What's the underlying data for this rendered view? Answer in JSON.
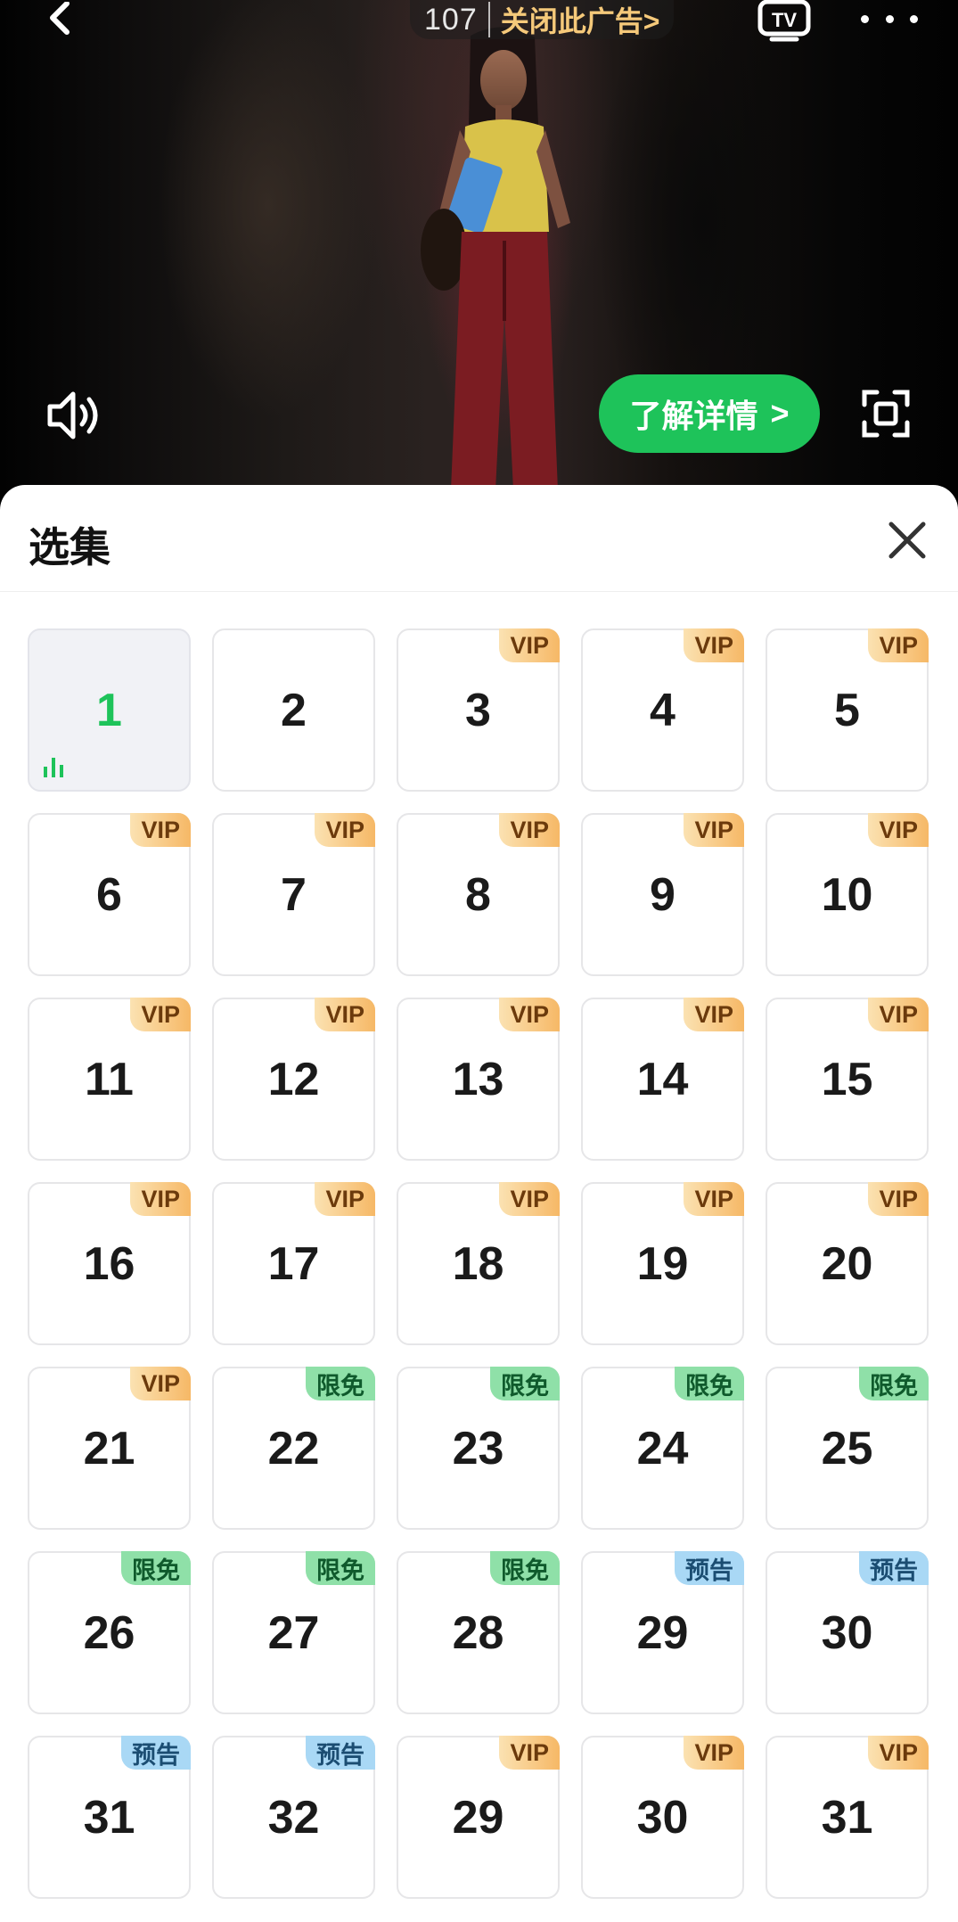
{
  "player": {
    "ad_countdown": "107",
    "close_ad_label": "关闭此广告>",
    "details_label": "了解详情",
    "details_chevron": ">",
    "icons": [
      "back-icon",
      "tv-cast-icon",
      "more-icon",
      "volume-icon",
      "fullscreen-icon"
    ]
  },
  "sheet": {
    "title": "选集",
    "close_icon": "close-icon"
  },
  "colors": {
    "accent_green": "#1ec35a",
    "vip_gold": "#f6b866",
    "free_green": "#8fe0a8",
    "preview_blue": "#a9d8f5"
  },
  "episodes": [
    {
      "num": "1",
      "badge": "",
      "type": "",
      "current": true
    },
    {
      "num": "2",
      "badge": "",
      "type": ""
    },
    {
      "num": "3",
      "badge": "VIP",
      "type": "vip"
    },
    {
      "num": "4",
      "badge": "VIP",
      "type": "vip"
    },
    {
      "num": "5",
      "badge": "VIP",
      "type": "vip"
    },
    {
      "num": "6",
      "badge": "VIP",
      "type": "vip"
    },
    {
      "num": "7",
      "badge": "VIP",
      "type": "vip"
    },
    {
      "num": "8",
      "badge": "VIP",
      "type": "vip"
    },
    {
      "num": "9",
      "badge": "VIP",
      "type": "vip"
    },
    {
      "num": "10",
      "badge": "VIP",
      "type": "vip"
    },
    {
      "num": "11",
      "badge": "VIP",
      "type": "vip"
    },
    {
      "num": "12",
      "badge": "VIP",
      "type": "vip"
    },
    {
      "num": "13",
      "badge": "VIP",
      "type": "vip"
    },
    {
      "num": "14",
      "badge": "VIP",
      "type": "vip"
    },
    {
      "num": "15",
      "badge": "VIP",
      "type": "vip"
    },
    {
      "num": "16",
      "badge": "VIP",
      "type": "vip"
    },
    {
      "num": "17",
      "badge": "VIP",
      "type": "vip"
    },
    {
      "num": "18",
      "badge": "VIP",
      "type": "vip"
    },
    {
      "num": "19",
      "badge": "VIP",
      "type": "vip"
    },
    {
      "num": "20",
      "badge": "VIP",
      "type": "vip"
    },
    {
      "num": "21",
      "badge": "VIP",
      "type": "vip"
    },
    {
      "num": "22",
      "badge": "限免",
      "type": "free"
    },
    {
      "num": "23",
      "badge": "限免",
      "type": "free"
    },
    {
      "num": "24",
      "badge": "限免",
      "type": "free"
    },
    {
      "num": "25",
      "badge": "限免",
      "type": "free"
    },
    {
      "num": "26",
      "badge": "限免",
      "type": "free"
    },
    {
      "num": "27",
      "badge": "限免",
      "type": "free"
    },
    {
      "num": "28",
      "badge": "限免",
      "type": "free"
    },
    {
      "num": "29",
      "badge": "预告",
      "type": "preview"
    },
    {
      "num": "30",
      "badge": "预告",
      "type": "preview"
    },
    {
      "num": "31",
      "badge": "预告",
      "type": "preview"
    },
    {
      "num": "32",
      "badge": "预告",
      "type": "preview"
    },
    {
      "num": "29",
      "badge": "VIP",
      "type": "vip"
    },
    {
      "num": "30",
      "badge": "VIP",
      "type": "vip"
    },
    {
      "num": "31",
      "badge": "VIP",
      "type": "vip"
    }
  ]
}
